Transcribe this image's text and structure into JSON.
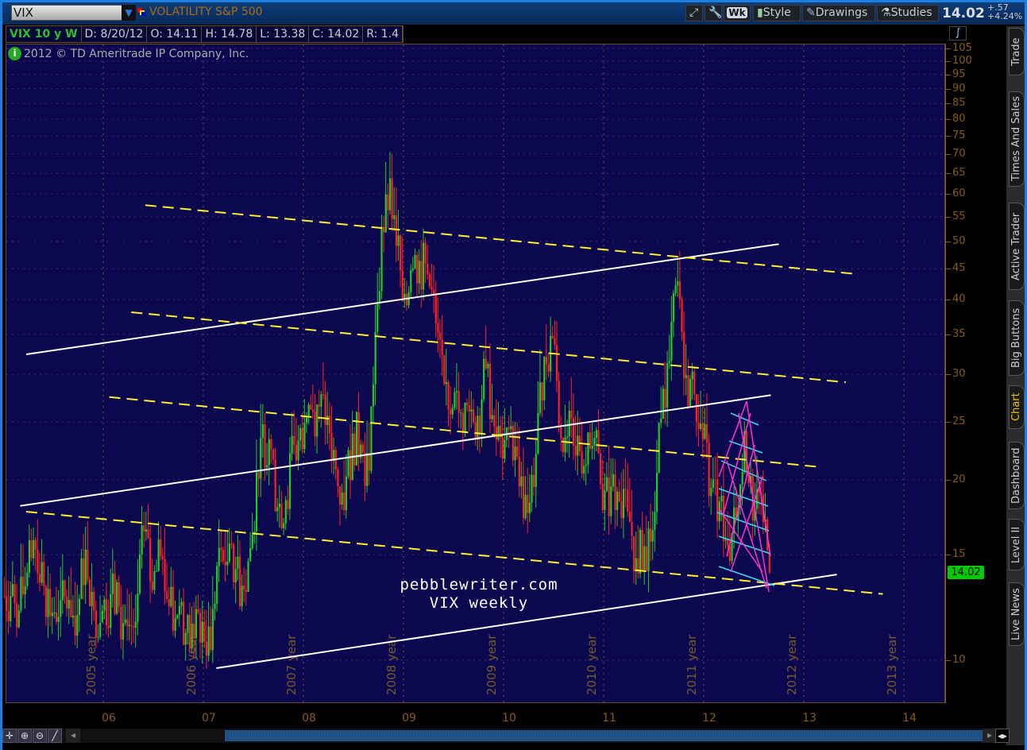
{
  "header": {
    "symbol": "VIX",
    "description": "VOLATILITY S&P 500",
    "buttons": [
      "Wk",
      "Style",
      "Drawings",
      "Studies"
    ],
    "last": "14.02",
    "change": "+.57",
    "change_pct": "+4.24%"
  },
  "info": {
    "title": "VIX 10 y W",
    "date": "D: 8/20/12",
    "open": "O: 14.11",
    "high": "H: 14.78",
    "low": "L: 13.38",
    "close": "C: 14.02",
    "range": "R: 1.4"
  },
  "copyright": "2012 © TD Ameritrade IP Company, Inc.",
  "watermark": {
    "line1": "pebblewriter.com",
    "line2": "VIX weekly"
  },
  "side_tabs": [
    {
      "label": "Trade"
    },
    {
      "label": "Times And Sales"
    },
    {
      "label": "Active Trader"
    },
    {
      "label": "Big Buttons"
    },
    {
      "label": "Chart",
      "active": true
    },
    {
      "label": "Dashboard"
    },
    {
      "label": "Level II"
    },
    {
      "label": "Live News"
    }
  ],
  "last_price_tag": "14.02",
  "chart_data": {
    "type": "candlestick",
    "title": "VIX 10 y W",
    "yscale": "log",
    "ylim": [
      8.6,
      115
    ],
    "yticks": [
      10,
      15,
      20,
      25,
      30,
      35,
      40,
      45,
      50,
      55,
      60,
      65,
      70,
      75,
      80,
      85,
      90,
      95,
      100,
      105
    ],
    "xlim": [
      2005.0,
      2014.4
    ],
    "xticks": [
      {
        "v": 2006,
        "label": "06"
      },
      {
        "v": 2007,
        "label": "07"
      },
      {
        "v": 2008,
        "label": "08"
      },
      {
        "v": 2009,
        "label": "09"
      },
      {
        "v": 2010,
        "label": "10"
      },
      {
        "v": 2011,
        "label": "11"
      },
      {
        "v": 2012,
        "label": "12"
      },
      {
        "v": 2013,
        "label": "13"
      },
      {
        "v": 2014,
        "label": "14"
      }
    ],
    "year_markers": [
      "2005 year",
      "2006 year",
      "2007 year",
      "2008 year",
      "2009 year",
      "2010 year",
      "2011 year",
      "2012 year",
      "2013 year"
    ],
    "monthly_close_start": 2005.0,
    "monthly_closes": [
      12.8,
      12.1,
      14.0,
      15.3,
      13.3,
      12.0,
      12.6,
      12.6,
      11.9,
      15.3,
      12.1,
      12.1,
      12.9,
      12.3,
      11.4,
      11.6,
      16.4,
      13.1,
      14.9,
      12.3,
      11.9,
      11.1,
      10.9,
      11.6,
      10.4,
      15.4,
      14.6,
      14.2,
      13.1,
      16.2,
      23.5,
      23.4,
      18.0,
      18.5,
      22.9,
      22.5,
      26.2,
      26.5,
      25.6,
      20.8,
      17.8,
      23.9,
      22.9,
      20.7,
      39.4,
      59.9,
      55.3,
      40.0,
      44.8,
      46.4,
      44.1,
      36.5,
      28.9,
      26.4,
      25.9,
      26.0,
      25.6,
      30.7,
      24.5,
      21.7,
      24.6,
      19.5,
      17.6,
      22.1,
      32.1,
      34.5,
      23.5,
      26.1,
      23.7,
      21.2,
      23.5,
      17.8,
      19.5,
      18.4,
      17.7,
      14.8,
      15.5,
      16.5,
      25.3,
      31.6,
      42.9,
      29.9,
      27.8,
      23.4,
      19.4,
      18.4,
      15.5,
      17.2,
      24.1,
      17.1,
      18.9,
      14.0
    ],
    "trendlines": [
      {
        "style": "white",
        "from": [
          2005.23,
          32.4
        ],
        "to": [
          2012.75,
          49.5
        ]
      },
      {
        "style": "white",
        "from": [
          2005.17,
          18.1
        ],
        "to": [
          2012.67,
          27.7
        ]
      },
      {
        "style": "white",
        "from": [
          2007.13,
          9.7
        ],
        "to": [
          2013.33,
          13.9
        ]
      },
      {
        "style": "yellow-dashed",
        "from": [
          2006.42,
          57.5
        ],
        "to": [
          2013.54,
          44.1
        ]
      },
      {
        "style": "yellow-dashed",
        "from": [
          2006.28,
          38.1
        ],
        "to": [
          2013.42,
          29.1
        ]
      },
      {
        "style": "yellow-dashed",
        "from": [
          2006.06,
          27.5
        ],
        "to": [
          2013.18,
          21.0
        ]
      },
      {
        "style": "yellow-dashed",
        "from": [
          2005.23,
          17.7
        ],
        "to": [
          2013.79,
          12.9
        ]
      }
    ],
    "colors": {
      "up": "#22cc22",
      "down": "#ff2020",
      "background": "#0c0850",
      "white_line": "#ffffff",
      "yellow_line": "#ffee33",
      "cyan": "#33ddee",
      "magenta": "#ff33cc"
    }
  }
}
